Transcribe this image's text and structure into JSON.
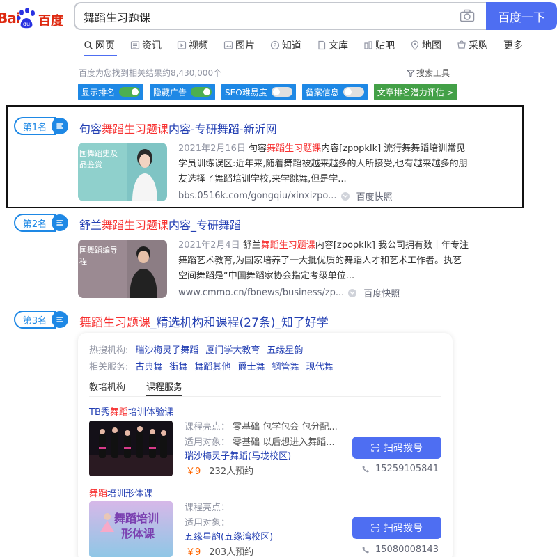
{
  "header": {
    "logo_left": "Bai",
    "logo_right": "百度",
    "query": "舞蹈生习题课",
    "search_button": "百度一下"
  },
  "tabs": [
    {
      "label": "网页",
      "icon": "search-icon"
    },
    {
      "label": "资讯",
      "icon": "news-icon"
    },
    {
      "label": "视频",
      "icon": "video-icon"
    },
    {
      "label": "图片",
      "icon": "image-icon"
    },
    {
      "label": "知道",
      "icon": "question-icon"
    },
    {
      "label": "文库",
      "icon": "doc-icon"
    },
    {
      "label": "贴吧",
      "icon": "tieba-icon"
    },
    {
      "label": "地图",
      "icon": "map-icon"
    },
    {
      "label": "采购",
      "icon": "cart-icon"
    },
    {
      "label": "更多",
      "icon": ""
    }
  ],
  "result_count": "百度为您找到相关结果约8,430,000个",
  "search_tools": "搜索工具",
  "toolbar": [
    {
      "label": "显示排名",
      "toggle": "on"
    },
    {
      "label": "隐藏广告",
      "toggle": "on"
    },
    {
      "label": "SEO难易度",
      "toggle": "off"
    },
    {
      "label": "备案信息",
      "toggle": "off"
    },
    {
      "label": "文章排名潜力评估 >",
      "toggle": "none"
    }
  ],
  "results": [
    {
      "rank": "第1名",
      "title_pre": "句容",
      "title_em": "舞蹈生习题课",
      "title_post": "内容-专研舞蹈-新沂网",
      "thumb_text": "国舞蹈史及\n品鉴赏",
      "date": "2021年2月16日",
      "desc_pre": "句容",
      "desc_em": "舞蹈生习题课",
      "desc_post": "内容[zpopklk] 流行舞舞蹈培训常见学员训练误区:近年来,随着舞蹈被越来越多的人所接受,也有越来越多的朋友选择了舞蹈培训学校,来学跳舞,但是学...",
      "url": "bbs.0516k.com/gongqiu/xinxizpo...",
      "snapshot": "百度快照"
    },
    {
      "rank": "第2名",
      "title_pre": "舒兰",
      "title_em": "舞蹈生习题课",
      "title_post": "内容_专研舞蹈",
      "thumb_text": "国舞蹈编导\n程",
      "date": "2021年2月4日",
      "desc_pre": "舒兰",
      "desc_em": "舞蹈生习题课",
      "desc_post": "内容[zpopklk] 我公司拥有数十年专注舞蹈艺术教育,为国家培养了一大批优质的舞蹈人才和艺术工作者。执艺空间舞蹈是“中国舞蹈家协会指定考级单位...",
      "url": "www.cmmo.cn/fbnews/business/zp...",
      "snapshot": "百度快照"
    },
    {
      "rank": "第3名",
      "title_em": "舞蹈生习题课",
      "title_post": "_精选机构和课程(27条)_知了好学"
    }
  ],
  "card": {
    "hot_label": "热搜机构:",
    "hot_items": [
      "瑞沙梅灵子舞蹈",
      "厦门学大教育",
      "五缘星韵"
    ],
    "related_label": "相关服务:",
    "related_items": [
      "古典舞",
      "街舞",
      "舞蹈其他",
      "爵士舞",
      "钢管舞",
      "现代舞"
    ],
    "tabs": [
      "教培机构",
      "课程服务"
    ],
    "courses": [
      {
        "title_pre": "TB秀",
        "title_em": "舞蹈",
        "title_post": "培训体验课",
        "highlight_label": "课程亮点：",
        "highlight": "零基础 包学包会 包分配...",
        "target_label": "适用对象：",
        "target": "零基础 以后想进入舞蹈...",
        "institution": "瑞沙梅灵子舞蹈(马垅校区)",
        "price": "￥9",
        "booked": "232人预约",
        "button": "扫码拨号",
        "phone": "15259105841"
      },
      {
        "title_pre": "",
        "title_em": "舞蹈",
        "title_post": "培训形体课",
        "thumb_text": "舞蹈培训\n形体课",
        "highlight_label": "课程亮点：",
        "highlight": "",
        "target_label": "适用对象：",
        "target": "",
        "institution": "五缘星韵(五缘湾校区)",
        "price": "￥9",
        "booked": "203人预约",
        "button": "扫码拨号",
        "phone": "15080008143"
      }
    ]
  }
}
